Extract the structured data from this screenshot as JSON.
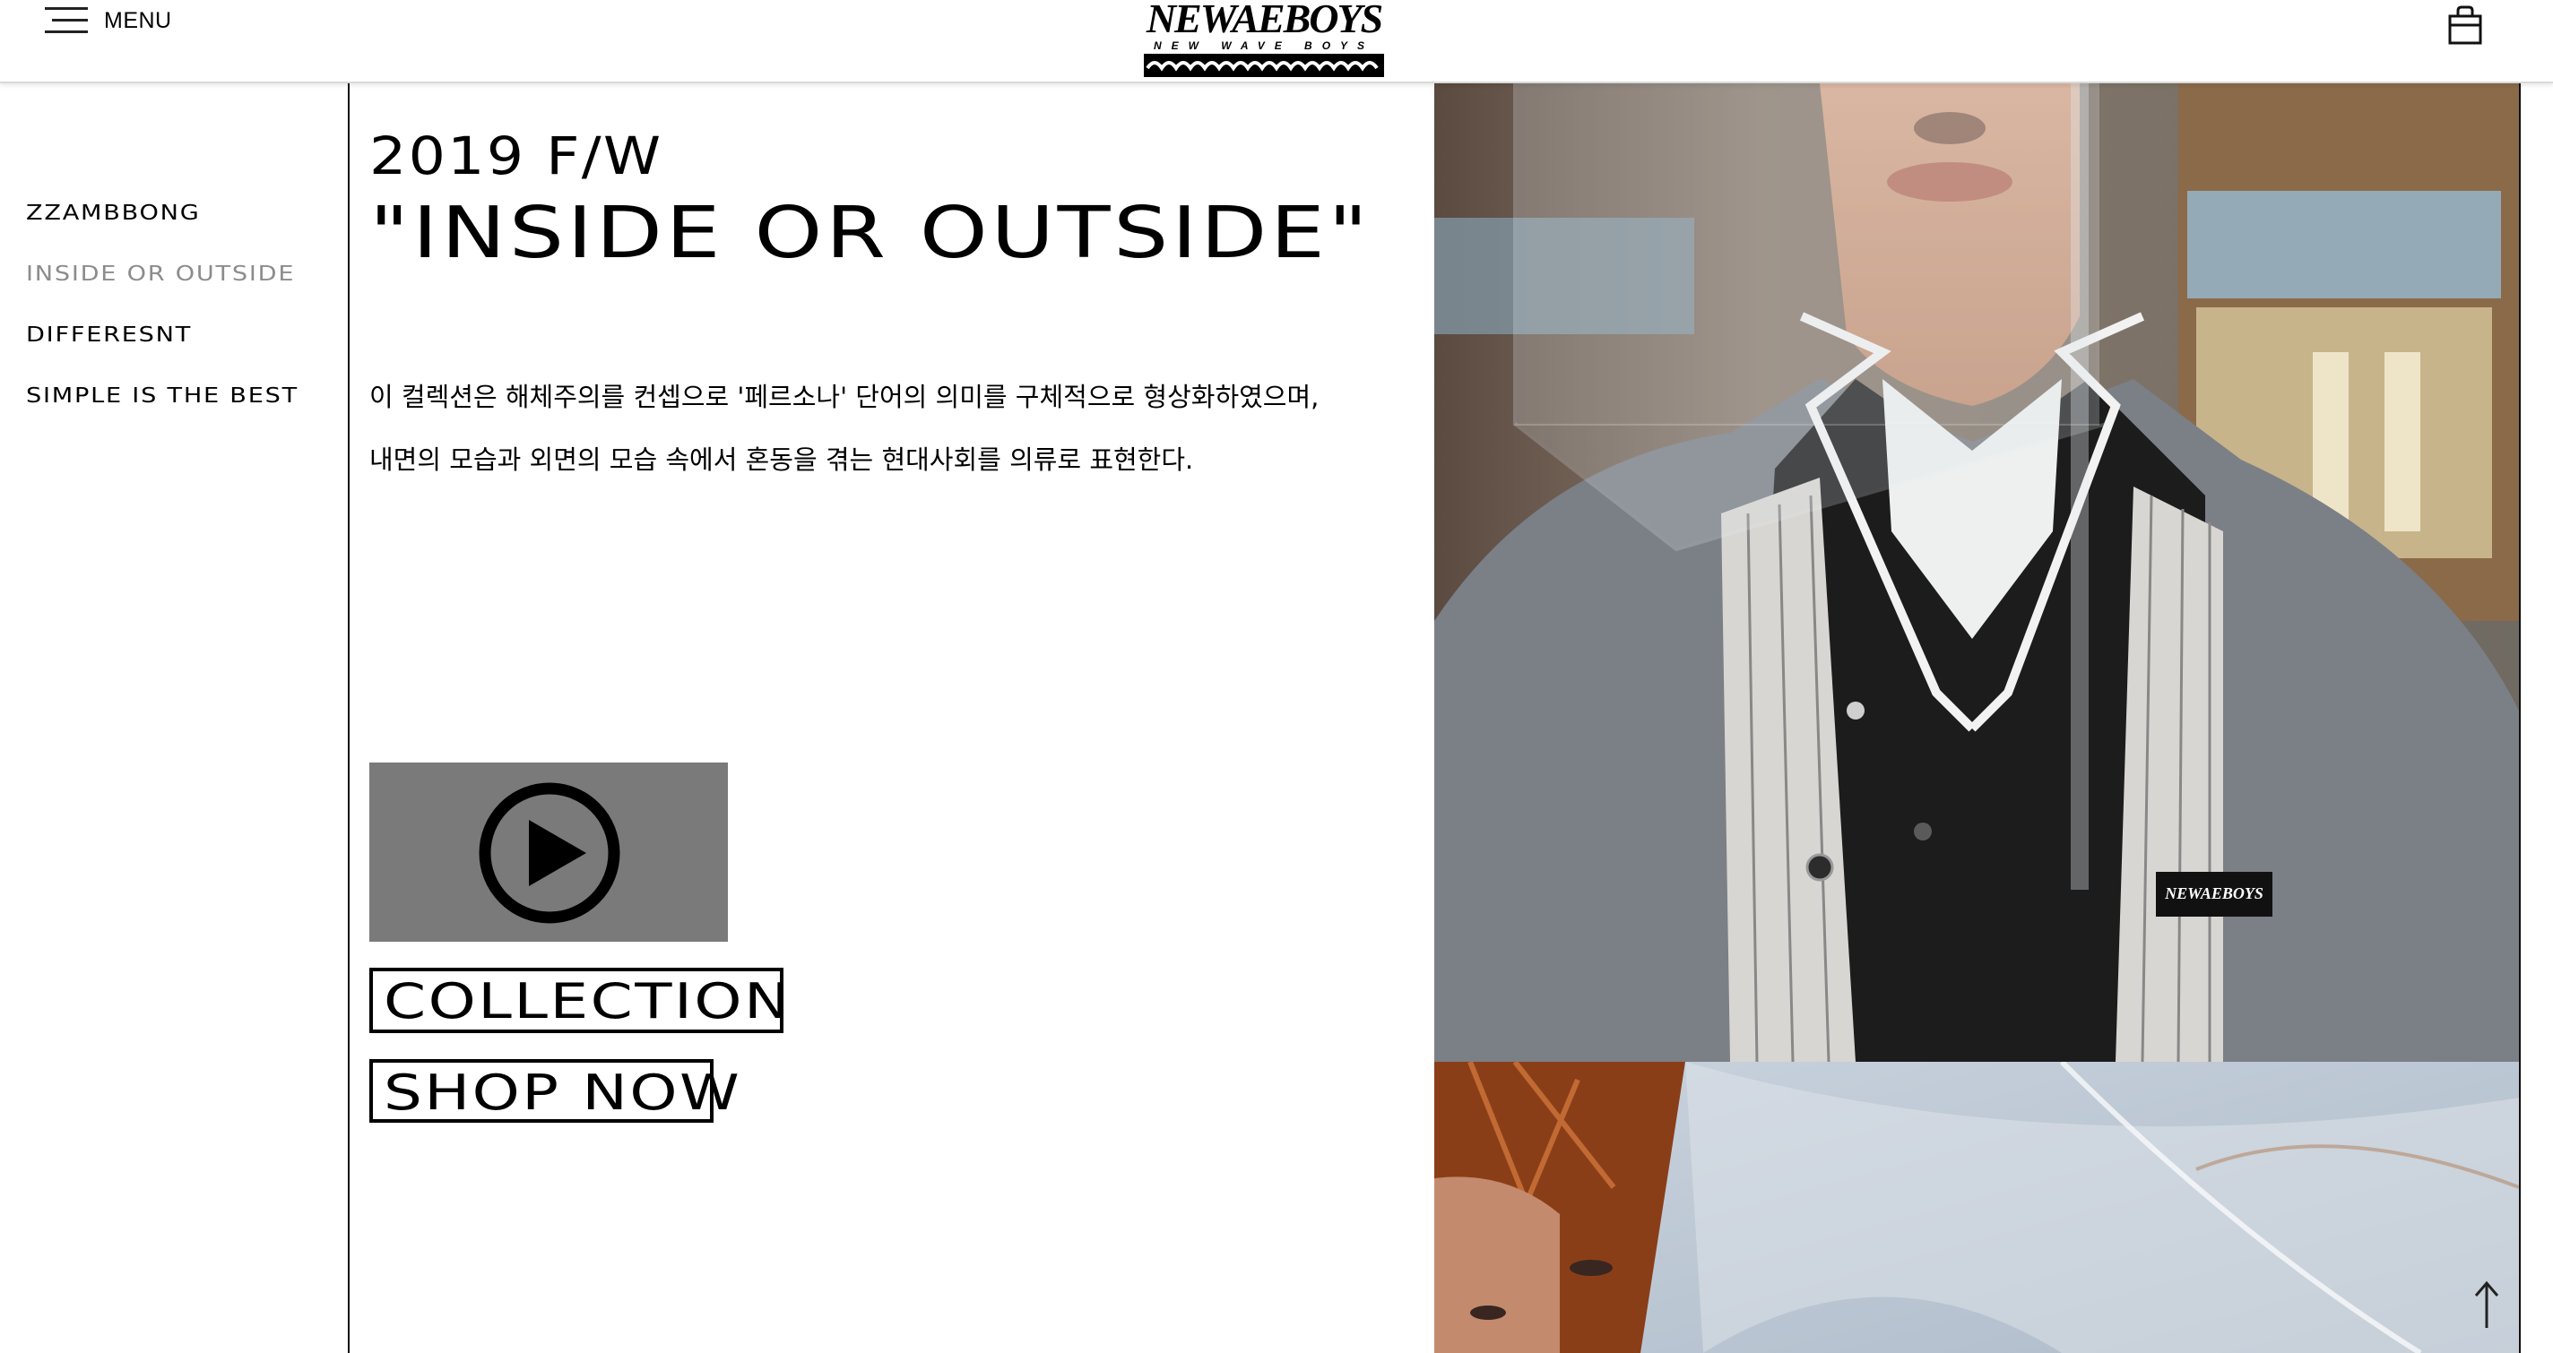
{
  "header": {
    "menu_label": "MENU",
    "logo_text": "NEWAEBOYS",
    "logo_subtext": "NEW WAVE BOYS",
    "cart_icon": "shopping-bag-icon"
  },
  "sidebar": {
    "items": [
      {
        "label": "ZZAMBBONG",
        "active": false
      },
      {
        "label": "INSIDE OR OUTSIDE",
        "active": true
      },
      {
        "label": "DIFFERESNT",
        "active": false
      },
      {
        "label": "SIMPLE IS THE BEST",
        "active": false
      }
    ]
  },
  "main": {
    "season": "2019 F/W",
    "title": "\"INSIDE OR OUTSIDE\"",
    "description_lines": [
      "이 컬렉션은 해체주의를 컨셉으로 '페르소나' 단어의 의미를 구체적으로 형상화하였으며,",
      "내면의 모습과 외면의 모습 속에서 혼동을 겪는 현대사회를 의류로 표현한다."
    ],
    "video": {
      "icon": "play-circle-icon",
      "background": "#7a7a7a"
    },
    "collection_button": "COLLECTION",
    "shop_button": "SHOP NOW"
  },
  "colors": {
    "text": "#000000",
    "active_nav": "#8c8c8c",
    "video_bg": "#7a7a7a",
    "header_border": "#d9d9d9"
  },
  "footer": {
    "scroll_top_icon": "arrow-up-icon"
  }
}
